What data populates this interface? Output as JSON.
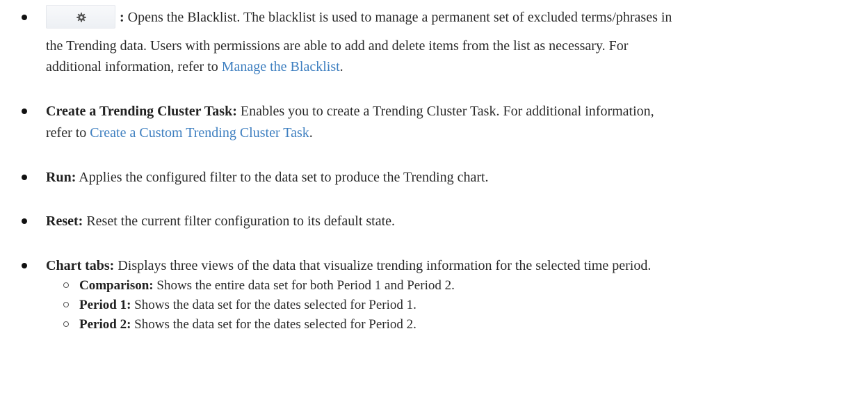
{
  "bullets": [
    {
      "label": ":",
      "text": "Opens the Blacklist. The blacklist is used to manage a permanent set of excluded terms/phrases in",
      "text_cont": "the Trending data. Users with permissions are able to add and delete items from the list as necessary. For",
      "text_cont2_before": "additional information, refer to ",
      "link": "Manage the Blacklist",
      "after_link": "."
    },
    {
      "label": "Create a Trending Cluster Task:",
      "text": "Enables you to create a Trending Cluster Task. For additional information,",
      "text_cont_before": "refer to ",
      "link": "Create a Custom Trending Cluster Task",
      "after_link": "."
    },
    {
      "label": "Run:",
      "text": "Applies the configured filter to the data set to produce the Trending chart."
    },
    {
      "label": "Reset:",
      "text": "Reset the current filter configuration to its default state."
    },
    {
      "label": "Chart tabs:",
      "text": "Displays three views of the data that visualize trending information for the selected time period.",
      "sub_items": [
        {
          "label": "Comparison:",
          "text": "Shows the entire data set for both Period 1 and Period 2."
        },
        {
          "label": "Period 1:",
          "text": "Shows the data set for the dates selected for Period 1."
        },
        {
          "label": "Period 2:",
          "text": "Shows the data set for the dates selected for Period 2."
        }
      ]
    }
  ],
  "icons": {
    "blacklist_button": "gear-icon"
  },
  "colors": {
    "link": "#3e7fc0"
  }
}
